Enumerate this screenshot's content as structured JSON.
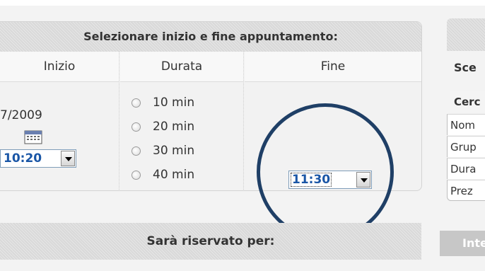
{
  "panel": {
    "header": "Selezionare inizio e fine appuntamento:",
    "columns": [
      "Inizio",
      "Durata",
      "Fine"
    ],
    "inizio": {
      "date": "7/2009",
      "time": "10:20"
    },
    "durata_options": [
      "10 min",
      "20 min",
      "30 min",
      "40 min"
    ],
    "fine": {
      "time": "11:30"
    }
  },
  "reserve_header": "Sarà riservato per:",
  "right_panel": {
    "title": "Sce",
    "subheader": "Cerc",
    "rows": [
      "Nom",
      "Grup",
      "Dura",
      "Prez"
    ],
    "bottom_label": "Inte"
  },
  "icons": {
    "calendar": "calendar-icon",
    "dropdown": "chevron-down-icon"
  },
  "colors": {
    "select_text": "#1a56a6",
    "highlight_circle": "#1f3f66",
    "header_bg": "#d9d9d9"
  }
}
